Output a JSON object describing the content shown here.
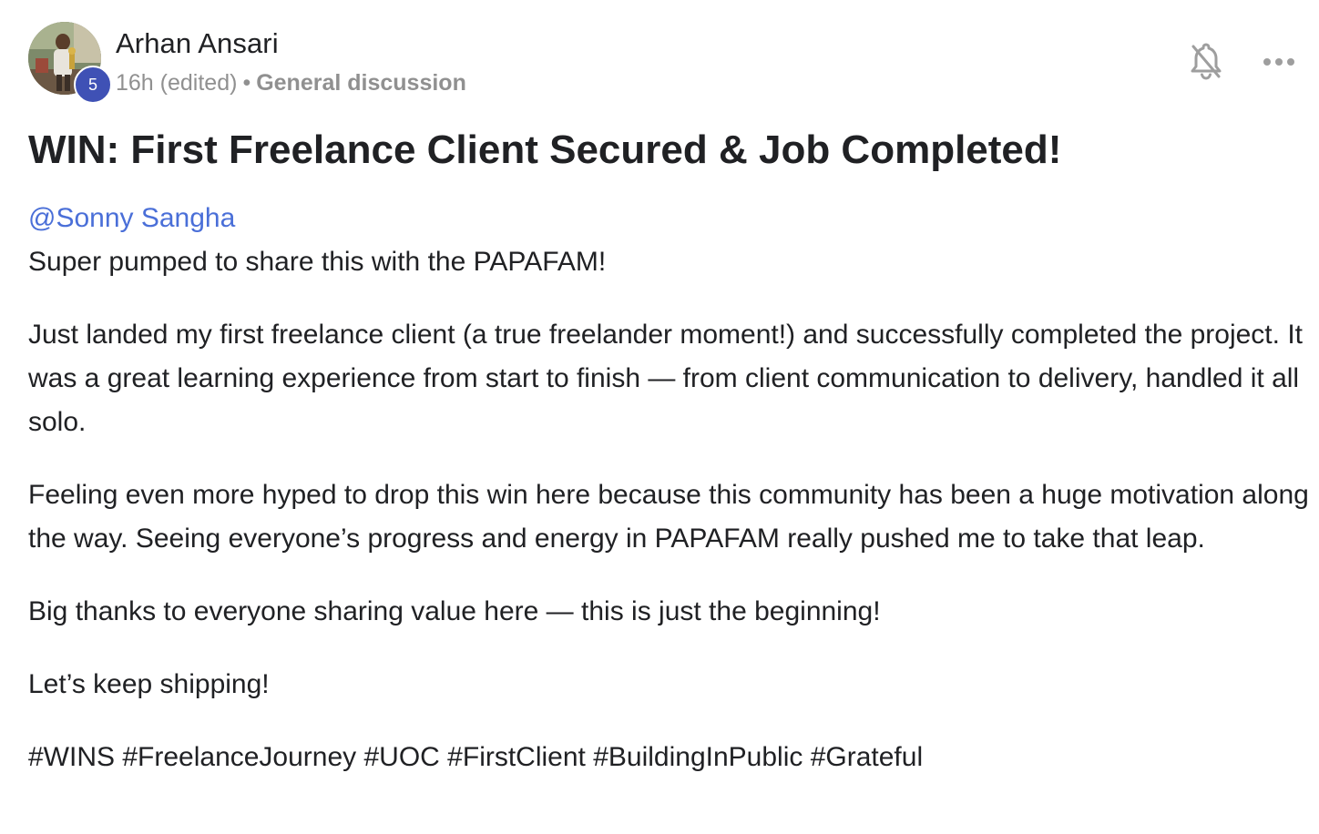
{
  "author": {
    "name": "Arhan Ansari",
    "level": "5",
    "time": "16h (edited)",
    "separator": "•",
    "category": "General discussion"
  },
  "post": {
    "title": "WIN: First Freelance Client Secured & Job Completed!",
    "mention": "@Sonny Sangha",
    "intro": "Super pumped to share this with the PAPAFAM!",
    "paragraph_1": "Just landed my first freelance client (a true freelander moment!) and successfully completed the project. It was a great learning experience from start to finish — from client communication to delivery, handled it all solo.",
    "paragraph_2": "Feeling even more hyped to drop this win here because this community has been a huge motivation along the way. Seeing everyone’s progress and energy in PAPAFAM really pushed me to take that leap.",
    "paragraph_3": "Big thanks to everyone sharing value here — this is just the beginning!",
    "paragraph_4": "Let’s keep shipping!",
    "hashtags": "#WINS #FreelanceJourney #UOC #FirstClient #BuildingInPublic #Grateful"
  },
  "actions": {
    "notification_icon": "bell-off-icon",
    "more_icon": "more-horizontal-icon"
  },
  "colors": {
    "badge": "#3f51b5",
    "mention": "#4a6fd8",
    "meta_text": "#909090",
    "icon": "#9e9e9e"
  }
}
